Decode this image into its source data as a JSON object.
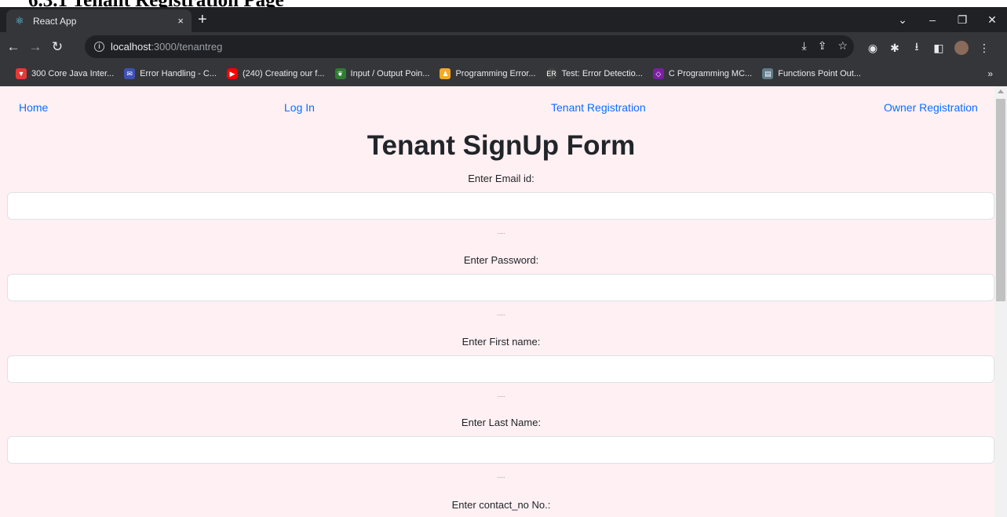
{
  "doc_heading": "6.3.1 Tenant Registration Page",
  "browser": {
    "tab_title": "React App",
    "tab_close": "×",
    "new_tab": "+",
    "url_host": "localhost",
    "url_path": ":3000/tenantreg",
    "window_controls": [
      "⌄",
      "–",
      "❐",
      "✕"
    ],
    "bookmarks": [
      {
        "label": "300 Core Java Inter...",
        "icon": "bookmark-icon-red",
        "color": "#e53935"
      },
      {
        "label": "Error Handling - C...",
        "icon": "bookmark-icon-blue",
        "color": "#3f51b5"
      },
      {
        "label": "(240) Creating our f...",
        "icon": "youtube-icon",
        "color": "#ff0000"
      },
      {
        "label": "Input / Output Poin...",
        "icon": "bookmark-icon-green",
        "color": "#2e7d32"
      },
      {
        "label": "Programming Error...",
        "icon": "bookmark-icon-orange",
        "color": "#f9a825"
      },
      {
        "label": "Test: Error Detectio...",
        "icon": "er-icon",
        "color": "#424242"
      },
      {
        "label": "C Programming MC...",
        "icon": "bookmark-icon-purple",
        "color": "#7b1fa2"
      },
      {
        "label": "Functions Point Out...",
        "icon": "bookmark-icon-gray",
        "color": "#607d8b"
      }
    ],
    "bookmarks_more": "»"
  },
  "nav": {
    "home": "Home",
    "login": "Log In",
    "tenant_registration": "Tenant Registration",
    "owner_registration": "Owner Registration"
  },
  "form": {
    "title": "Tenant SignUp Form",
    "fields": [
      {
        "label": "Enter Email id:",
        "value": "",
        "hint": "...."
      },
      {
        "label": "Enter Password:",
        "value": "",
        "hint": "...."
      },
      {
        "label": "Enter First name:",
        "value": "",
        "hint": "...."
      },
      {
        "label": "Enter Last Name:",
        "value": "",
        "hint": "...."
      },
      {
        "label": "Enter contact_no No.:"
      }
    ]
  }
}
